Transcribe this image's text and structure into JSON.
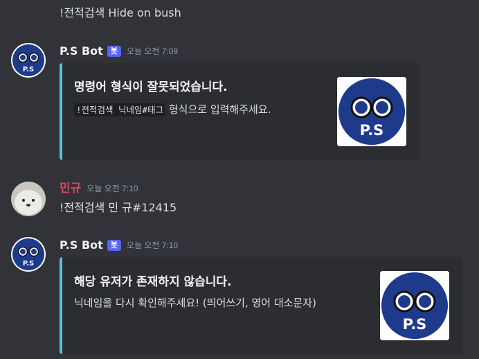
{
  "messages": {
    "m0": {
      "text": "!전적검색 Hide on bush"
    },
    "m1": {
      "username": "P.S Bot",
      "bot_tag": "봇",
      "timestamp": "오늘 오전 7:09",
      "avatar_text": "P.S",
      "embed": {
        "title": "명령어 형식이 잘못되었습니다.",
        "code": "!전적검색 닉네임#태그",
        "desc_suffix": " 형식으로 입력해주세요.",
        "thumbnail_text": "P.S"
      }
    },
    "m2": {
      "username": "민규",
      "timestamp": "오늘 오전 7:10",
      "text": "!전적검색 민 규#12415"
    },
    "m3": {
      "username": "P.S Bot",
      "bot_tag": "봇",
      "timestamp": "오늘 오전 7:10",
      "avatar_text": "P.S",
      "embed": {
        "title": "해당 유저가 존재하지 않습니다.",
        "desc": "닉네임을 다시 확인해주세요! (띄어쓰기, 영어 대소문자)",
        "thumbnail_text": "P.S"
      }
    }
  },
  "colors": {
    "background": "#313338",
    "embed_bg": "#2b2d31",
    "embed_accent": "#5bc0de",
    "bot_tag": "#5865f2",
    "user_name": "#e0435f",
    "logo_navy": "#1e3a8a"
  }
}
